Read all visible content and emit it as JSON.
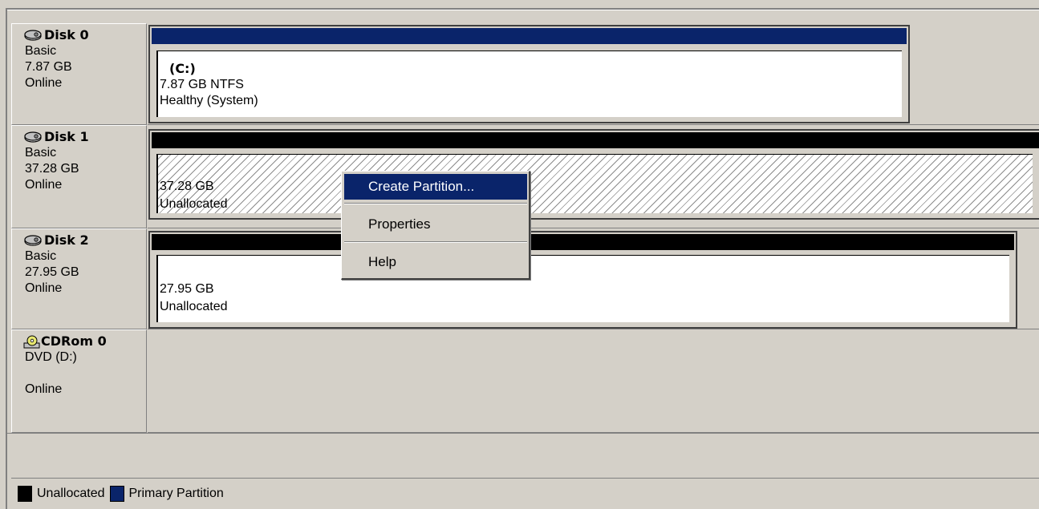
{
  "disks": [
    {
      "name": "Disk 0",
      "lines": [
        "Basic",
        "7.87 GB",
        "Online"
      ],
      "partition": {
        "header_color": "#0a246a",
        "label": "(C:)",
        "size": "7.87 GB NTFS",
        "status": "Healthy (System)"
      }
    },
    {
      "name": "Disk 1",
      "lines": [
        "Basic",
        "37.28 GB",
        "Online"
      ],
      "partition": {
        "header_color": "#000000",
        "size": "37.28 GB",
        "status": "Unallocated"
      }
    },
    {
      "name": "Disk 2",
      "lines": [
        "Basic",
        "27.95 GB",
        "Online"
      ],
      "partition": {
        "header_color": "#000000",
        "size": "27.95 GB",
        "status": "Unallocated"
      }
    },
    {
      "name": "CDRom 0",
      "lines": [
        "DVD (D:)",
        "",
        "Online"
      ]
    }
  ],
  "context_menu": {
    "items": [
      "Create Partition...",
      "Properties",
      "Help"
    ]
  },
  "legend": {
    "items": [
      {
        "label": "Unallocated",
        "color": "#000000"
      },
      {
        "label": "Primary Partition",
        "color": "#0a246a"
      }
    ]
  }
}
